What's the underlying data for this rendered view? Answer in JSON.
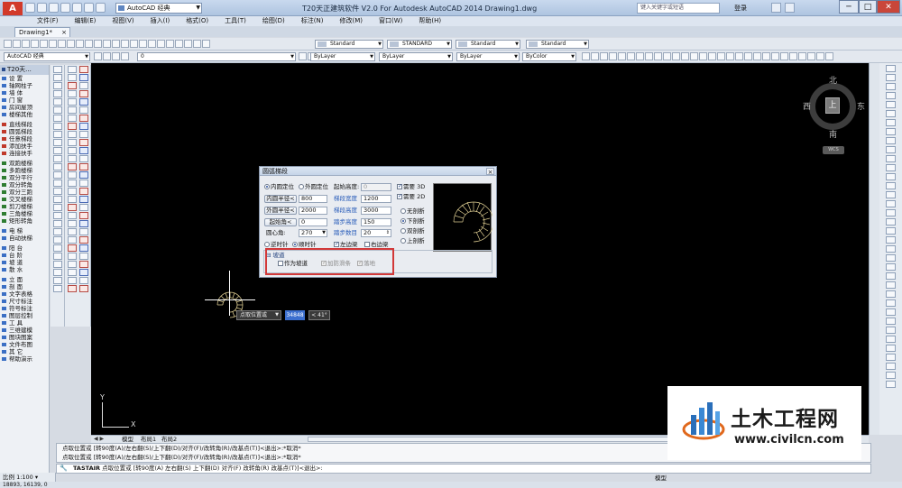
{
  "titlebar": {
    "workspace": "AutoCAD 经典",
    "title": "T20天正建筑软件 V2.0 For Autodesk AutoCAD 2014      Drawing1.dwg",
    "search_placeholder": "键入关键字或短语",
    "sign_in": "登录",
    "minimize": "─",
    "maximize": "□",
    "close": "✕"
  },
  "menu": [
    "文件(F)",
    "编辑(E)",
    "视图(V)",
    "插入(I)",
    "格式(O)",
    "工具(T)",
    "绘图(D)",
    "标注(N)",
    "修改(M)",
    "窗口(W)",
    "帮助(H)"
  ],
  "file_tab": {
    "label": "Drawing1*",
    "close": "×"
  },
  "toolbar": {
    "text_style": "Standard",
    "dim_style": "STANDARD",
    "table_style": "Standard",
    "mleader_style": "Standard",
    "workspace2": "AutoCAD 经典",
    "layer": "0",
    "color": "ByLayer",
    "linetype": "ByLayer",
    "lineweight": "ByLayer",
    "plotstyle": "ByColor"
  },
  "t20_panel": {
    "title": "T20天...",
    "items": [
      {
        "label": "设    置",
        "mark": "#3b6fc4"
      },
      {
        "label": "轴网柱子",
        "mark": "#3b6fc4"
      },
      {
        "label": "墙    体",
        "mark": "#3b6fc4"
      },
      {
        "label": "门    窗",
        "mark": "#3b6fc4"
      },
      {
        "label": "房间屋顶",
        "mark": "#3b6fc4"
      },
      {
        "label": "楼梯其他",
        "mark": "#3b6fc4"
      },
      {
        "label": "直线梯段",
        "mark": "#c0392b"
      },
      {
        "label": "圆弧梯段",
        "mark": "#c0392b"
      },
      {
        "label": "任意梯段",
        "mark": "#c0392b"
      },
      {
        "label": "添加扶手",
        "mark": "#c0392b"
      },
      {
        "label": "连接扶手",
        "mark": "#c0392b"
      },
      {
        "label": "双跑楼梯",
        "mark": "#2e7d32"
      },
      {
        "label": "多跑楼梯",
        "mark": "#2e7d32"
      },
      {
        "label": "双分平行",
        "mark": "#2e7d32"
      },
      {
        "label": "双分转角",
        "mark": "#2e7d32"
      },
      {
        "label": "双分三跑",
        "mark": "#2e7d32"
      },
      {
        "label": "交叉楼梯",
        "mark": "#2e7d32"
      },
      {
        "label": "剪刀楼梯",
        "mark": "#2e7d32"
      },
      {
        "label": "三角楼梯",
        "mark": "#2e7d32"
      },
      {
        "label": "矩形转角",
        "mark": "#2e7d32"
      },
      {
        "label": "电    梯",
        "mark": "#3b6fc4"
      },
      {
        "label": "自动扶梯",
        "mark": "#3b6fc4"
      },
      {
        "label": "阳    台",
        "mark": "#3b6fc4"
      },
      {
        "label": "台    阶",
        "mark": "#3b6fc4"
      },
      {
        "label": "坡    道",
        "mark": "#3b6fc4"
      },
      {
        "label": "散    水",
        "mark": "#3b6fc4"
      },
      {
        "label": "立    面",
        "mark": "#3b6fc4"
      },
      {
        "label": "剖    面",
        "mark": "#3b6fc4"
      },
      {
        "label": "文字表格",
        "mark": "#3b6fc4"
      },
      {
        "label": "尺寸标注",
        "mark": "#3b6fc4"
      },
      {
        "label": "符号标注",
        "mark": "#3b6fc4"
      },
      {
        "label": "图层控制",
        "mark": "#3b6fc4"
      },
      {
        "label": "工    具",
        "mark": "#3b6fc4"
      },
      {
        "label": "三维建模",
        "mark": "#3b6fc4"
      },
      {
        "label": "图块图案",
        "mark": "#3b6fc4"
      },
      {
        "label": "文件布图",
        "mark": "#3b6fc4"
      },
      {
        "label": "其    它",
        "mark": "#3b6fc4"
      },
      {
        "label": "帮助演示",
        "mark": "#3b6fc4"
      }
    ]
  },
  "viewcube": {
    "north": "北",
    "south": "南",
    "east": "东",
    "west": "西",
    "top": "上",
    "wcs": "WCS"
  },
  "ucs": {
    "y": "Y",
    "x": "X"
  },
  "dynamic_input": {
    "prompt": "点取位置或",
    "value": "34848",
    "angle": "< 41°"
  },
  "layout_tabs": {
    "model": "模型",
    "layout1": "布局1",
    "layout2": "布局2"
  },
  "dialog": {
    "title": "圆弧梯段",
    "close": "×",
    "inner_locate": "内圆定位",
    "outer_locate": "外圆定位",
    "inner_radius_btn": "内圆半径<",
    "inner_radius": "800",
    "outer_radius_btn": "外圆半径<",
    "outer_radius": "2000",
    "start_angle_btn": "起始角<",
    "start_angle": "0",
    "center_angle_label": "圆心角:",
    "center_angle": "270",
    "counterclockwise": "逆时针",
    "clockwise": "顺时针",
    "left_edge": "左边梁",
    "right_edge": "右边梁",
    "start_height_label": "起始高度:",
    "start_height": "0",
    "flight_width_label": "梯段宽度",
    "flight_width": "1200",
    "flight_height_label": "梯段高度",
    "flight_height": "3000",
    "step_height_label": "踏步高度",
    "step_height": "150",
    "step_count_label": "踏步数目",
    "step_count": "20",
    "need_3d": "需要 3D",
    "need_2d": "需要 2D",
    "no_break": "无剖断",
    "lower_break": "下剖断",
    "double_break": "双剖断",
    "upper_break": "上剖断",
    "ramp_section": "坡道",
    "as_ramp": "作为坡道",
    "add_antislip": "加防滑条",
    "landing": "落地"
  },
  "command": {
    "history": [
      "点取位置或 [转90度(A)/左右翻(S)/上下翻(D)/对齐(F)/改转角(R)/改基点(T)]<退出>:*取消*",
      "点取位置或 [转90度(A)/左右翻(S)/上下翻(D)/对齐(F)/改转角(R)/改基点(T)]<退出>:*取消*"
    ],
    "current_name": "TASTAIR",
    "current_prompt": " 点取位置或 [转90度(A) 左右翻(S) 上下翻(D) 对齐(F) 改转角(R) 改基点(T)]<退出>:"
  },
  "status": {
    "scale": "比例 1:100 ▾",
    "coords": "18893, 16139, 0",
    "model": "模型"
  },
  "watermark": {
    "cn": "土木工程网",
    "url": "www.civilcn.com"
  }
}
